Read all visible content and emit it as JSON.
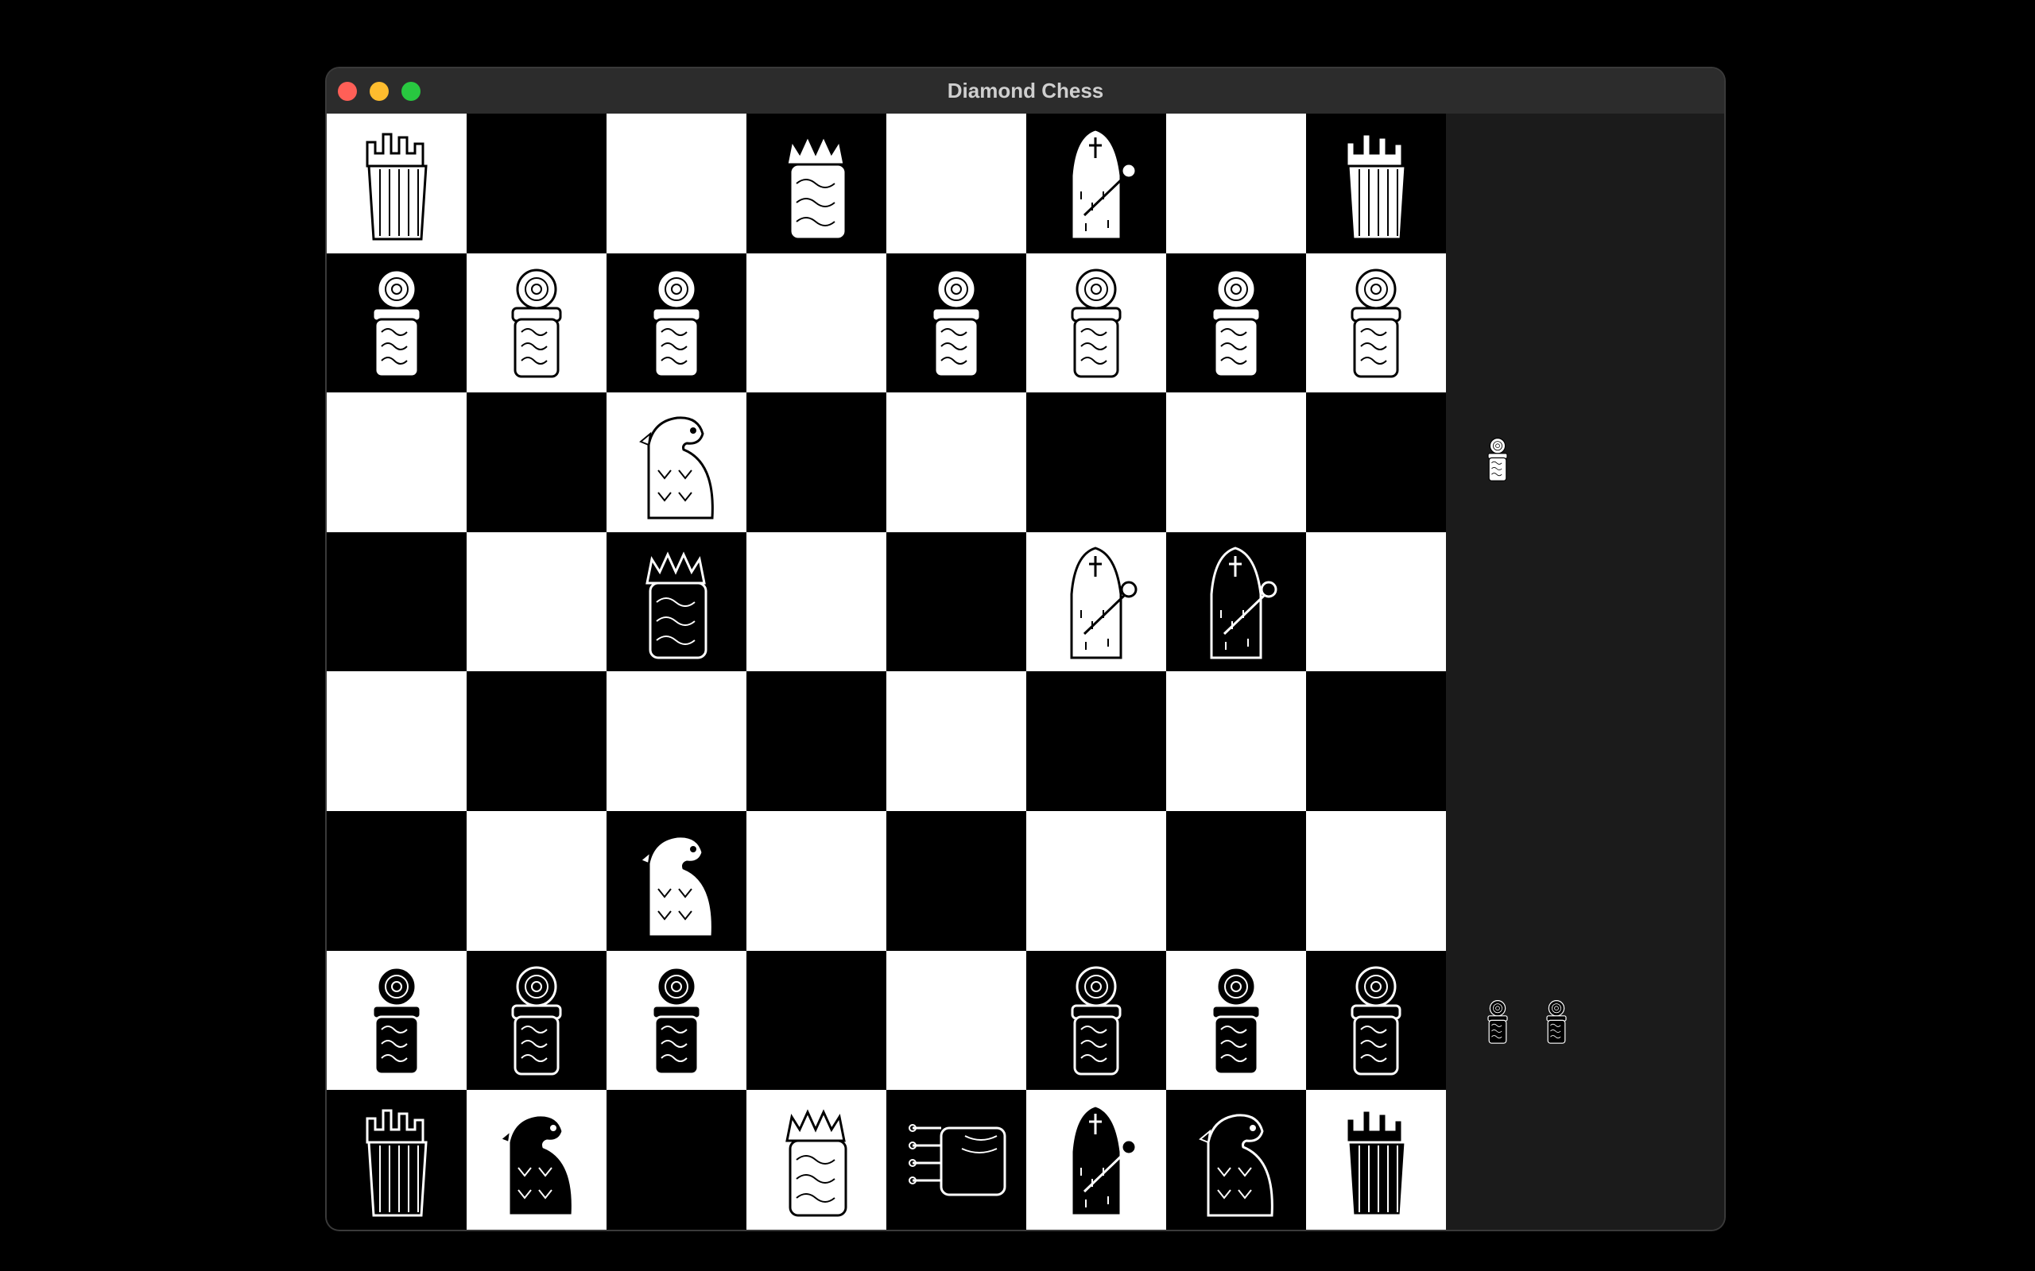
{
  "window": {
    "title": "Diamond Chess"
  },
  "colors": {
    "light_square": "#ffffff",
    "dark_square": "#000000",
    "panel": "#1b1b1b"
  },
  "board": [
    [
      "wR",
      "",
      "",
      "wQ",
      "",
      "wB",
      "",
      "wR"
    ],
    [
      "wP",
      "wP",
      "wP",
      "",
      "wP",
      "wP",
      "wP",
      "wP"
    ],
    [
      "",
      "",
      "wN",
      "",
      "",
      "",
      "",
      ""
    ],
    [
      "",
      "",
      "bQ",
      "",
      "",
      "wB",
      "bB",
      ""
    ],
    [
      "",
      "",
      "",
      "",
      "",
      "",
      "",
      ""
    ],
    [
      "",
      "",
      "wN",
      "",
      "",
      "",
      "",
      ""
    ],
    [
      "bP",
      "bP",
      "bP",
      "",
      "",
      "bP",
      "bP",
      "bP"
    ],
    [
      "bR",
      "bN",
      "",
      "wQ",
      "bK",
      "bB",
      "bN",
      "bR"
    ]
  ],
  "captured": {
    "top": [
      "wP"
    ],
    "bottom": [
      "bP",
      "bP"
    ]
  },
  "piece_names": {
    "P": "pawn",
    "R": "rook",
    "N": "knight",
    "B": "bishop",
    "Q": "queen",
    "K": "king"
  }
}
